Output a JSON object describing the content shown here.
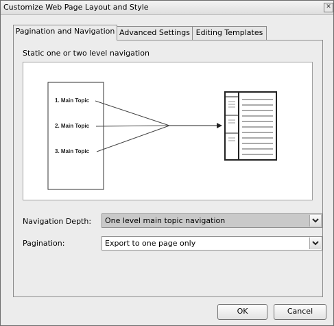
{
  "window": {
    "title": "Customize Web Page Layout and Style"
  },
  "tabs": [
    {
      "label": "Pagination and Navigation",
      "active": true
    },
    {
      "label": "Advanced Settings",
      "active": false
    },
    {
      "label": "Editing Templates",
      "active": false
    }
  ],
  "panel": {
    "heading": "Static one or two level navigation",
    "diagram_topics": [
      "1. Main Topic",
      "2. Main Topic",
      "3. Main Topic"
    ]
  },
  "navigation_depth": {
    "label": "Navigation Depth:",
    "value": "One level main topic navigation"
  },
  "pagination": {
    "label": "Pagination:",
    "value": "Export to one page only"
  },
  "buttons": {
    "ok": "OK",
    "cancel": "Cancel"
  },
  "icons": {
    "close": "close-icon",
    "dropdown": "chevron-down-icon"
  }
}
